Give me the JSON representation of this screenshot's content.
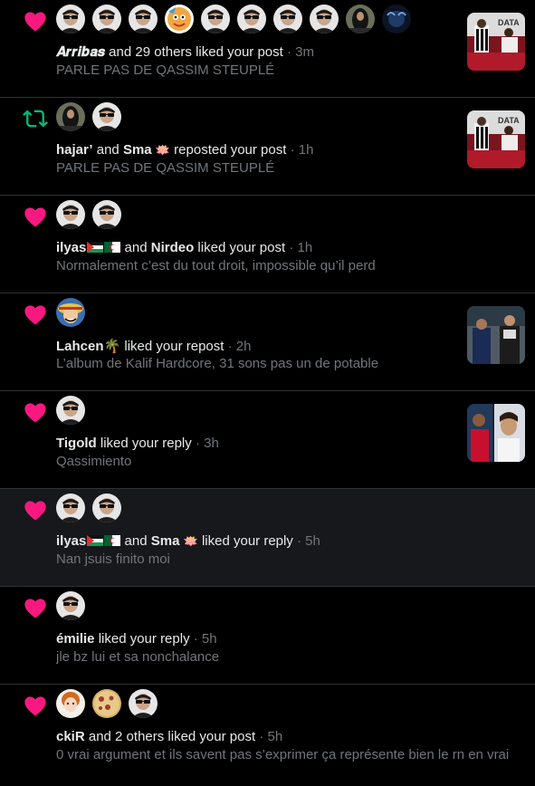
{
  "notifications": [
    {
      "type": "like",
      "avatars": [
        "sunglasses",
        "sunglasses",
        "sunglasses",
        "cartoon",
        "sunglasses",
        "sunglasses",
        "sunglasses",
        "sunglasses",
        "woman",
        "dark-blue"
      ],
      "name1": "𝑨𝒓𝒓𝒊𝒃𝒂𝒔",
      "rest": " and 29 others liked your post",
      "time": "· 3m",
      "preview": "PARLE PAS DE QASSIM STEUPLÉ",
      "thumb": "studio"
    },
    {
      "type": "repost",
      "avatars": [
        "woman",
        "sunglasses"
      ],
      "name1": "hajar’",
      "mid": " and ",
      "name2": "Sma",
      "name2_emoji": "🪷",
      "rest": " reposted your post",
      "time": "· 1h",
      "preview": "PARLE PAS DE QASSIM STEUPLÉ",
      "thumb": "studio"
    },
    {
      "type": "like",
      "avatars": [
        "sunglasses",
        "sunglasses"
      ],
      "name1": "ilyas",
      "name1_flags": true,
      "mid": " and ",
      "name2": "Nirdeo",
      "rest": " liked your post",
      "time": "· 1h",
      "preview": "Normalement c’est du tout droit, impossible qu’il perd",
      "thumb": ""
    },
    {
      "type": "like",
      "avatars": [
        "luffy"
      ],
      "name1": "Lahcen",
      "name1_emoji": "🌴",
      "rest": " liked your repost",
      "time": "· 2h",
      "preview": "L’album de Kalif Hardcore, 31 sons pas un de potable",
      "thumb": "football"
    },
    {
      "type": "like",
      "avatars": [
        "sunglasses"
      ],
      "name1": "Tigold",
      "rest": " liked your reply",
      "time": "· 3h",
      "preview": "Qassimiento",
      "thumb": "players"
    },
    {
      "type": "like",
      "highlight": true,
      "avatars": [
        "sunglasses",
        "sunglasses"
      ],
      "name1": "ilyas",
      "name1_flags": true,
      "mid": " and ",
      "name2": "Sma",
      "name2_emoji": "🪷",
      "rest": " liked your reply",
      "time": "· 5h",
      "preview": "Nan jsuis finito moi",
      "thumb": ""
    },
    {
      "type": "like",
      "avatars": [
        "sunglasses"
      ],
      "name1": "émilie",
      "rest": " liked your reply",
      "time": "· 5h",
      "preview": "jle bz lui et sa nonchalance",
      "thumb": ""
    },
    {
      "type": "like",
      "avatars": [
        "doll",
        "pizza",
        "sunglasses"
      ],
      "name1": "ckiR",
      "rest": " and 2 others liked your post",
      "time": "· 5h",
      "preview": "0 vrai argument et ils savent pas s’exprimer ça représente bien le rn en vrai",
      "thumb": ""
    }
  ],
  "colors": {
    "like": "#f91880",
    "repost": "#00ba7c",
    "muted": "#71767b",
    "divider": "#2f3336"
  }
}
